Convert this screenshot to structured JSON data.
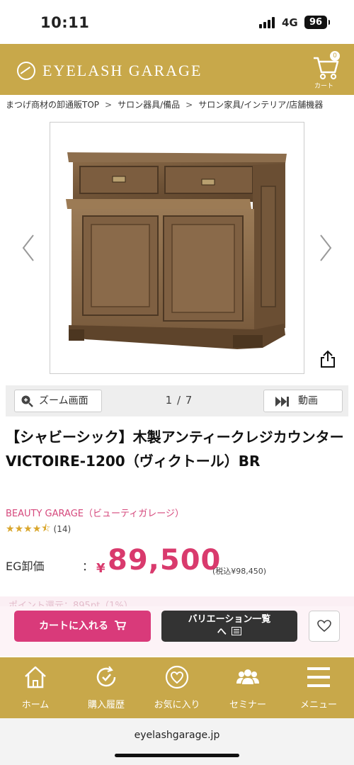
{
  "status": {
    "time": "10:11",
    "network": "4G",
    "battery": "96"
  },
  "header": {
    "logo_text": "EYELASH GARAGE",
    "cart_count": "0",
    "cart_label": "カート",
    "bg_color": "#c8a84a"
  },
  "breadcrumb": [
    "まつげ商材の卸通販TOP",
    "サロン器具/備品",
    "サロン家具/インテリア/店舗機器"
  ],
  "gallery": {
    "page_indicator": "1 / 7",
    "zoom_label": "ズーム画面",
    "video_label": "動画"
  },
  "product": {
    "title": "【シャビーシック】木製アンティークレジカウンター VICTOIRE-1200（ヴィクトール）BR",
    "brand": "BEAUTY GARAGE（ビューティガレージ）",
    "rating": 4.5,
    "review_count": "(14)",
    "price_label": "EG卸価",
    "price_colon": "：",
    "price_currency": "¥",
    "price": "89,500",
    "price_tax": "(税込¥98,450)",
    "points_text": "ポイント還元：895pt（1%）",
    "accent_color": "#d93a6d"
  },
  "actions": {
    "add_to_cart": "カートに入れる",
    "variations_line1": "バリエーション一覧",
    "variations_line2": "へ"
  },
  "bottom_nav": [
    {
      "label": "ホーム",
      "icon": "home-icon"
    },
    {
      "label": "購入履歴",
      "icon": "history-icon"
    },
    {
      "label": "お気に入り",
      "icon": "heart-icon"
    },
    {
      "label": "セミナー",
      "icon": "seminar-icon"
    },
    {
      "label": "メニュー",
      "icon": "menu-icon"
    }
  ],
  "browser": {
    "url": "eyelashgarage.jp"
  }
}
